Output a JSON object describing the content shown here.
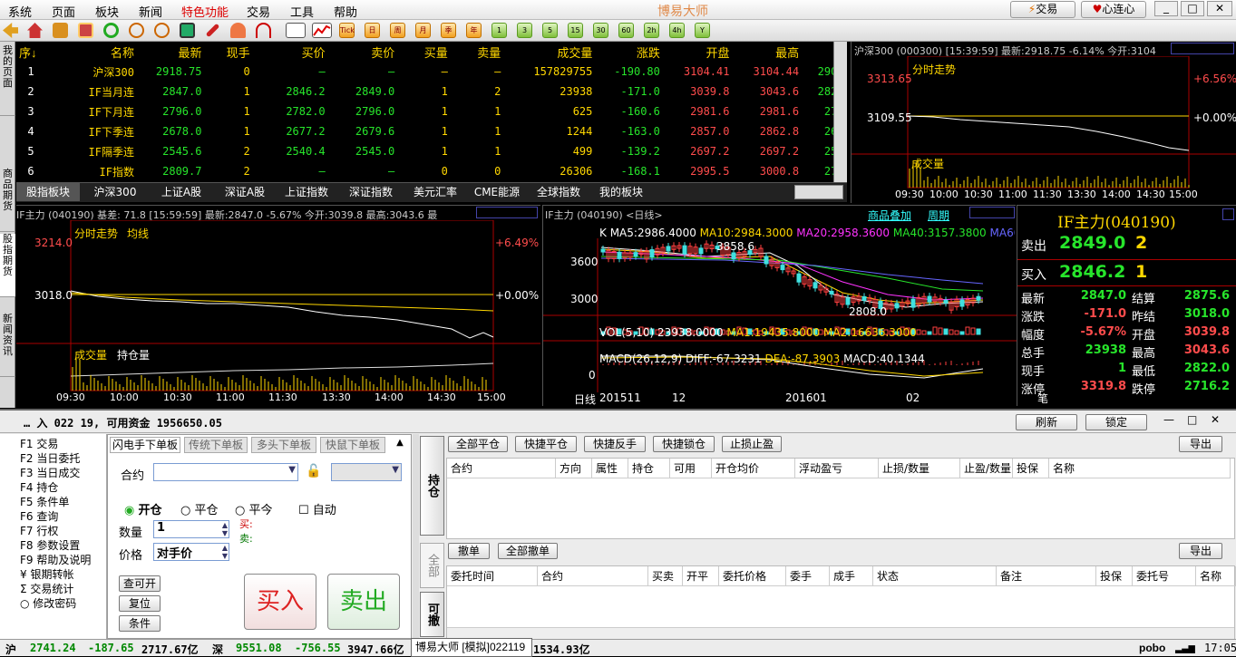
{
  "menu": {
    "items": [
      "系统",
      "页面",
      "板块",
      "新闻",
      "特色功能",
      "交易",
      "工具",
      "帮助"
    ],
    "app_title": "博易大师",
    "trade_btn": "交易",
    "xinlian_btn": "心连心"
  },
  "toolbar": {
    "period_buttons": [
      "Tick",
      "日",
      "周",
      "月",
      "季",
      "年",
      "1",
      "3",
      "5",
      "15",
      "30",
      "60",
      "2h",
      "4h",
      "Y"
    ]
  },
  "side_tabs": [
    "我的页面",
    "商品期货",
    "股指期货",
    "新闻资讯"
  ],
  "quote": {
    "headers": [
      "序↓",
      "名称",
      "最新",
      "现手",
      "买价",
      "卖价",
      "买量",
      "卖量",
      "成交量",
      "涨跌",
      "开盘",
      "最高",
      "最低"
    ],
    "rows": [
      [
        "1",
        "沪深300",
        "2918.75",
        "0",
        "—",
        "—",
        "—",
        "—",
        "157829755",
        "-190.80",
        "3104.41",
        "3104.44",
        "2905.4"
      ],
      [
        "2",
        "IF当月连",
        "2847.0",
        "1",
        "2846.2",
        "2849.0",
        "1",
        "2",
        "23938",
        "-171.0",
        "3039.8",
        "3043.6",
        "2822.0"
      ],
      [
        "3",
        "IF下月连",
        "2796.0",
        "1",
        "2782.0",
        "2796.0",
        "1",
        "1",
        "625",
        "-160.6",
        "2981.6",
        "2981.6",
        "2760."
      ],
      [
        "4",
        "IF下季连",
        "2678.0",
        "1",
        "2677.2",
        "2679.6",
        "1",
        "1",
        "1244",
        "-163.0",
        "2857.0",
        "2862.8",
        "2650."
      ],
      [
        "5",
        "IF隔季连",
        "2545.6",
        "2",
        "2540.4",
        "2545.0",
        "1",
        "1",
        "499",
        "-139.2",
        "2697.2",
        "2697.2",
        "2520."
      ],
      [
        "6",
        "IF指数",
        "2809.7",
        "2",
        "—",
        "—",
        "0",
        "0",
        "26306",
        "-168.1",
        "2995.5",
        "3000.8",
        "2784."
      ]
    ],
    "tabs": [
      "股指板块",
      "沪深300",
      "上证A股",
      "深证A股",
      "上证指数",
      "深证指数",
      "美元汇率",
      "CME能源",
      "全球指数",
      "我的板块"
    ]
  },
  "mini_chart": {
    "header": "沪深300 (000300)  [15:39:59] 最新:2918.75 -6.14% 今开:3104",
    "title": "分时走势",
    "top_price": "3313.65",
    "mid_price": "3109.55",
    "top_pct": "+6.56%",
    "mid_pct": "+0.00%",
    "vol_label": "成交量",
    "times": [
      "09:30",
      "10:00",
      "10:30",
      "11:00",
      "11:30",
      "13:30",
      "14:00",
      "14:30",
      "15:00"
    ]
  },
  "intraday": {
    "header": "IF主力 (040190) 基差: 71.8 [15:59:59] 最新:2847.0 -5.67% 今开:3039.8 最高:3043.6 最",
    "basis": "71.8",
    "title": "分时走势",
    "avg_label": "均线",
    "top_price": "3214.0",
    "mid_price": "3018.0",
    "top_pct": "+6.49%",
    "mid_pct": "+0.00%",
    "vol_label": "成交量",
    "oi_label": "持仓量",
    "times": [
      "09:30",
      "10:00",
      "10:30",
      "11:00",
      "11:30",
      "13:30",
      "14:00",
      "14:30",
      "15:00"
    ]
  },
  "kline": {
    "header": "IF主力 (040190)  <日线>",
    "overlay_btn": "商品叠加",
    "period_btn": "周期",
    "ma_line": [
      "K",
      "MA5:2986.4000",
      "MA10:2984.3000",
      "MA20:2958.3600",
      "MA40:3157.3800",
      "MA60:332"
    ],
    "high_label": "3858.6",
    "low_label": "2808.0",
    "y_ticks": [
      "3600",
      "3000"
    ],
    "vol_line": [
      "VOL(5,10)",
      "23938.0000",
      "MA1:19435.8000",
      "MA2:16636.3000"
    ],
    "macd_line": [
      "MACD(26,12,9)",
      "DIFF:-67.3231",
      "DEA:-87.3903",
      "MACD:40.1344"
    ],
    "macd_zero": "0",
    "x_labels": [
      "日线",
      "201511",
      "12",
      "201601",
      "02"
    ]
  },
  "detail": {
    "title": "IF主力(040190)",
    "sell_label": "卖出",
    "sell_price": "2849.0",
    "sell_vol": "2",
    "buy_label": "买入",
    "buy_price": "2846.2",
    "buy_vol": "1",
    "rows": [
      [
        "最新",
        "2847.0",
        "结算",
        "2875.6"
      ],
      [
        "涨跌",
        "-171.0",
        "昨结",
        "3018.0"
      ],
      [
        "幅度",
        "-5.67%",
        "开盘",
        "3039.8"
      ],
      [
        "总手",
        "23938",
        "最高",
        "3043.6"
      ],
      [
        "现手",
        "1",
        "最低",
        "2822.0"
      ],
      [
        "涨停",
        "3319.8",
        "跌停",
        "2716.2"
      ]
    ],
    "extra": "笔"
  },
  "trade": {
    "account_info": "… 入 022 19, 可用资金 1956650.05",
    "refresh_btn": "刷新",
    "lock_btn": "锁定",
    "nav": [
      "F1 交易",
      "F2 当日委托",
      "F3 当日成交",
      "F4 持仓",
      "F5 条件单",
      "F6 查询",
      "F7 行权",
      "F8 参数设置",
      "F9 帮助及说明",
      "¥ 银期转帐",
      "Σ 交易统计",
      "○ 修改密码"
    ],
    "order_tabs": [
      "闪电手下单板",
      "传统下单板",
      "多头下单板",
      "快鼠下单板"
    ],
    "contract_label": "合约",
    "radio_open": "开仓",
    "radio_close": "平仓",
    "radio_close_today": "平今",
    "check_auto": "自动",
    "qty_label": "数量",
    "qty_value": "1",
    "price_label": "价格",
    "price_value": "对手价",
    "buy_hint": "买:",
    "sell_hint": "卖:",
    "btn_query": "查可开",
    "btn_reset": "复位",
    "btn_cond": "条件",
    "btn_buy": "买入",
    "btn_sell": "卖出",
    "vtabs": [
      "持仓",
      "全部",
      "可撤"
    ],
    "pos_buttons": [
      "全部平仓",
      "快捷平仓",
      "快捷反手",
      "快捷锁仓",
      "止损止盈"
    ],
    "export_btn": "导出",
    "pos_headers": [
      "合约",
      "方向",
      "属性",
      "持仓",
      "可用",
      "开仓均价",
      "浮动盈亏",
      "止损/数量",
      "止盈/数量",
      "投保",
      "名称"
    ],
    "ord_buttons": [
      "撤单",
      "全部撤单"
    ],
    "ord_headers": [
      "委托时间",
      "合约",
      "买卖",
      "开平",
      "委托价格",
      "委手",
      "成手",
      "状态",
      "备注",
      "投保",
      "委托号",
      "名称"
    ]
  },
  "status": {
    "sh_label": "沪",
    "sh_price": "2741.24",
    "sh_chg": "-187.65",
    "sh_amt": "2717.67亿",
    "sz_label": "深",
    "sz_price": "9551.08",
    "sz_chg": "-756.55",
    "sz_amt": "3947.66亿",
    "taskbar": "博易大师 [模拟]022119",
    "amt3": "1534.93亿",
    "brand": "pobo",
    "time": "17:05"
  }
}
